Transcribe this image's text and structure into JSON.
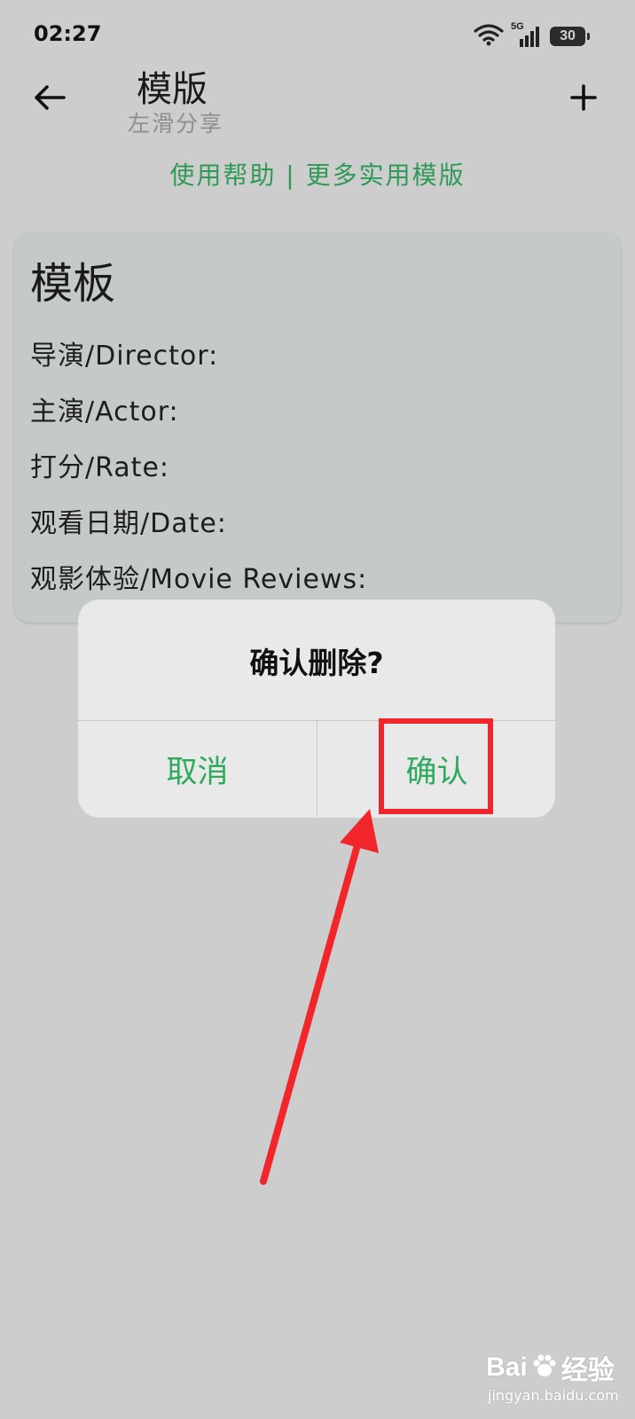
{
  "status_bar": {
    "time": "02:27",
    "network": "5G",
    "battery": "30"
  },
  "header": {
    "title": "模版",
    "subtitle": "左滑分享"
  },
  "help_links": {
    "help": "使用帮助",
    "separator": " | ",
    "more": "更多实用模版"
  },
  "template_card": {
    "title": "模板",
    "lines": [
      "导演/Director:",
      "主演/Actor:",
      "打分/Rate:",
      "观看日期/Date:",
      "观影体验/Movie Reviews:"
    ]
  },
  "dialog": {
    "title": "确认删除?",
    "cancel_label": "取消",
    "confirm_label": "确认"
  },
  "watermark": {
    "brand_left": "Bai",
    "brand_right": "经验",
    "domain": "jingyan.baidu.com"
  },
  "colors": {
    "accent_green": "#2eaa5c",
    "annotation_red": "#f0262b",
    "background": "#cdcdcd"
  }
}
